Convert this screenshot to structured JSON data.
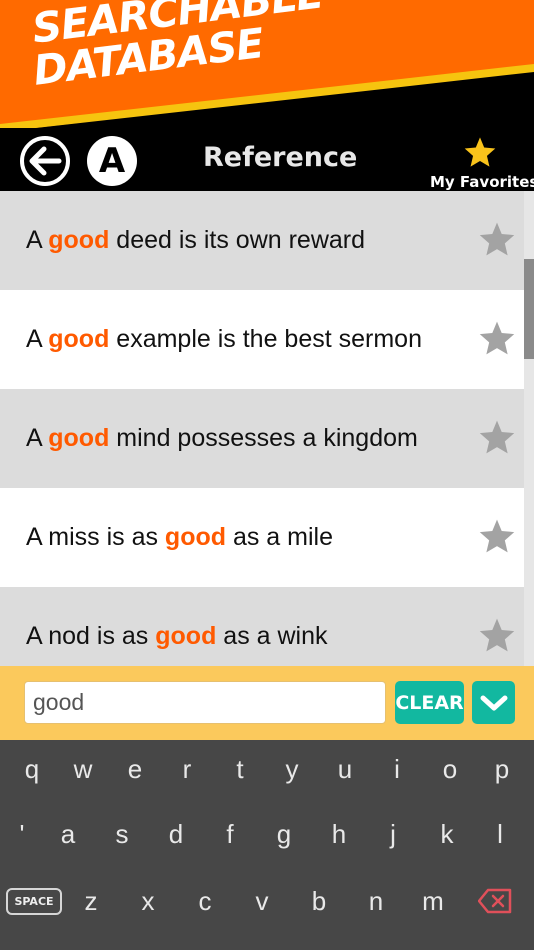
{
  "banner": {
    "title_line1": "SEARCHABLE",
    "title_line2": "DATABASE",
    "accent_color": "#ff6a00",
    "stripe_color": "#f6c40f"
  },
  "toolbar": {
    "back_icon": "arrow-left-icon",
    "font_button_label": "A",
    "title": "Reference",
    "favorites_icon": "star-icon",
    "favorites_label": "My Favorites"
  },
  "results": [
    {
      "before": "A ",
      "match": "good",
      "after": " deed is its own reward",
      "favorite": false
    },
    {
      "before": "A ",
      "match": "good",
      "after": " example is the best sermon",
      "favorite": false
    },
    {
      "before": "A ",
      "match": "good",
      "after": " mind possesses a kingdom",
      "favorite": false
    },
    {
      "before": "A miss is as ",
      "match": "good",
      "after": " as a mile",
      "favorite": false
    },
    {
      "before": "A nod is as ",
      "match": "good",
      "after": " as a wink",
      "favorite": false
    }
  ],
  "highlight_color": "#ff5a00",
  "search": {
    "value": "good",
    "clear_label": "CLEAR",
    "collapse_icon": "chevron-down-icon"
  },
  "keyboard": {
    "row1": [
      "q",
      "w",
      "e",
      "r",
      "t",
      "y",
      "u",
      "i",
      "o",
      "p"
    ],
    "row2": [
      "'",
      "a",
      "s",
      "d",
      "f",
      "g",
      "h",
      "j",
      "k",
      "l"
    ],
    "row3": [
      "z",
      "x",
      "c",
      "v",
      "b",
      "n",
      "m"
    ],
    "space_label": "SPACE",
    "backspace_icon": "backspace-icon"
  }
}
